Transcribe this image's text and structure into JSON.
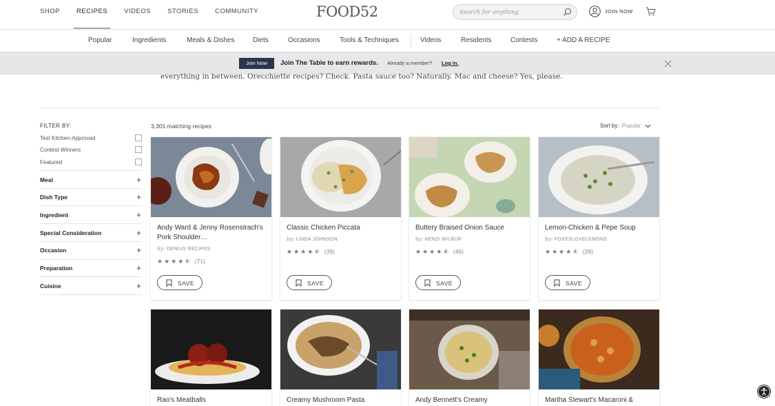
{
  "topnav": {
    "links": [
      {
        "label": "SHOP"
      },
      {
        "label": "RECIPES"
      },
      {
        "label": "VIDEOS"
      },
      {
        "label": "STORIES"
      },
      {
        "label": "COMMUNITY"
      }
    ],
    "logo": "FOOD52",
    "search_placeholder": "Search for anything",
    "join_label": "JOIN NOW"
  },
  "subnav": [
    {
      "label": "Popular"
    },
    {
      "label": "Ingredients"
    },
    {
      "label": "Meals & Dishes"
    },
    {
      "label": "Diets"
    },
    {
      "label": "Occasions"
    },
    {
      "label": "Tools & Techniques"
    },
    {
      "label": "Videos"
    },
    {
      "label": "Residents"
    },
    {
      "label": "Contests"
    },
    {
      "label": "+ ADD A RECIPE"
    }
  ],
  "banner": {
    "button": "Join Now",
    "message": "Join The Table to earn rewards.",
    "member": "Already a member?",
    "login": "Log in."
  },
  "intro": "everything in between. Orecchiette recipes? Check. Pasta sauce too? Naturally. Mac and cheese? Yes, please.",
  "filters": {
    "title": "FILTER BY:",
    "checks": [
      "Test Kitchen-Approved",
      "Contest Winners",
      "Featured"
    ],
    "facets": [
      "Meal",
      "Dish Type",
      "Ingredient",
      "Special Consideration",
      "Occasion",
      "Preparation",
      "Cuisine"
    ]
  },
  "results": {
    "count": "3,301 matching recipes",
    "sort_label": "Sort by:",
    "sort_value": "Popular"
  },
  "save_label": "SAVE",
  "by_prefix": "by:",
  "recipes": [
    {
      "title": "Andy Ward & Jenny Rosenstrach's Pork Shoulder…",
      "author": "GENIUS RECIPES",
      "rating": 4.5,
      "reviews": "(71)"
    },
    {
      "title": "Classic Chicken Piccata",
      "author": "LINDA JOHNSON",
      "rating": 4.5,
      "reviews": "(39)"
    },
    {
      "title": "Buttery Braised Onion Sauce",
      "author": "KENZI WILBUR",
      "rating": 4.5,
      "reviews": "(46)"
    },
    {
      "title": "Lemon-Chicken & Pepe Soup",
      "author": "FOXESLOVELEMONS",
      "rating": 4.5,
      "reviews": "(28)"
    },
    {
      "title": "Rao's Meatballs"
    },
    {
      "title": "Creamy Mushroom Pasta"
    },
    {
      "title": "Andy Bennett's Creamy"
    },
    {
      "title": "Martha Stewart's Macaroni &"
    }
  ]
}
